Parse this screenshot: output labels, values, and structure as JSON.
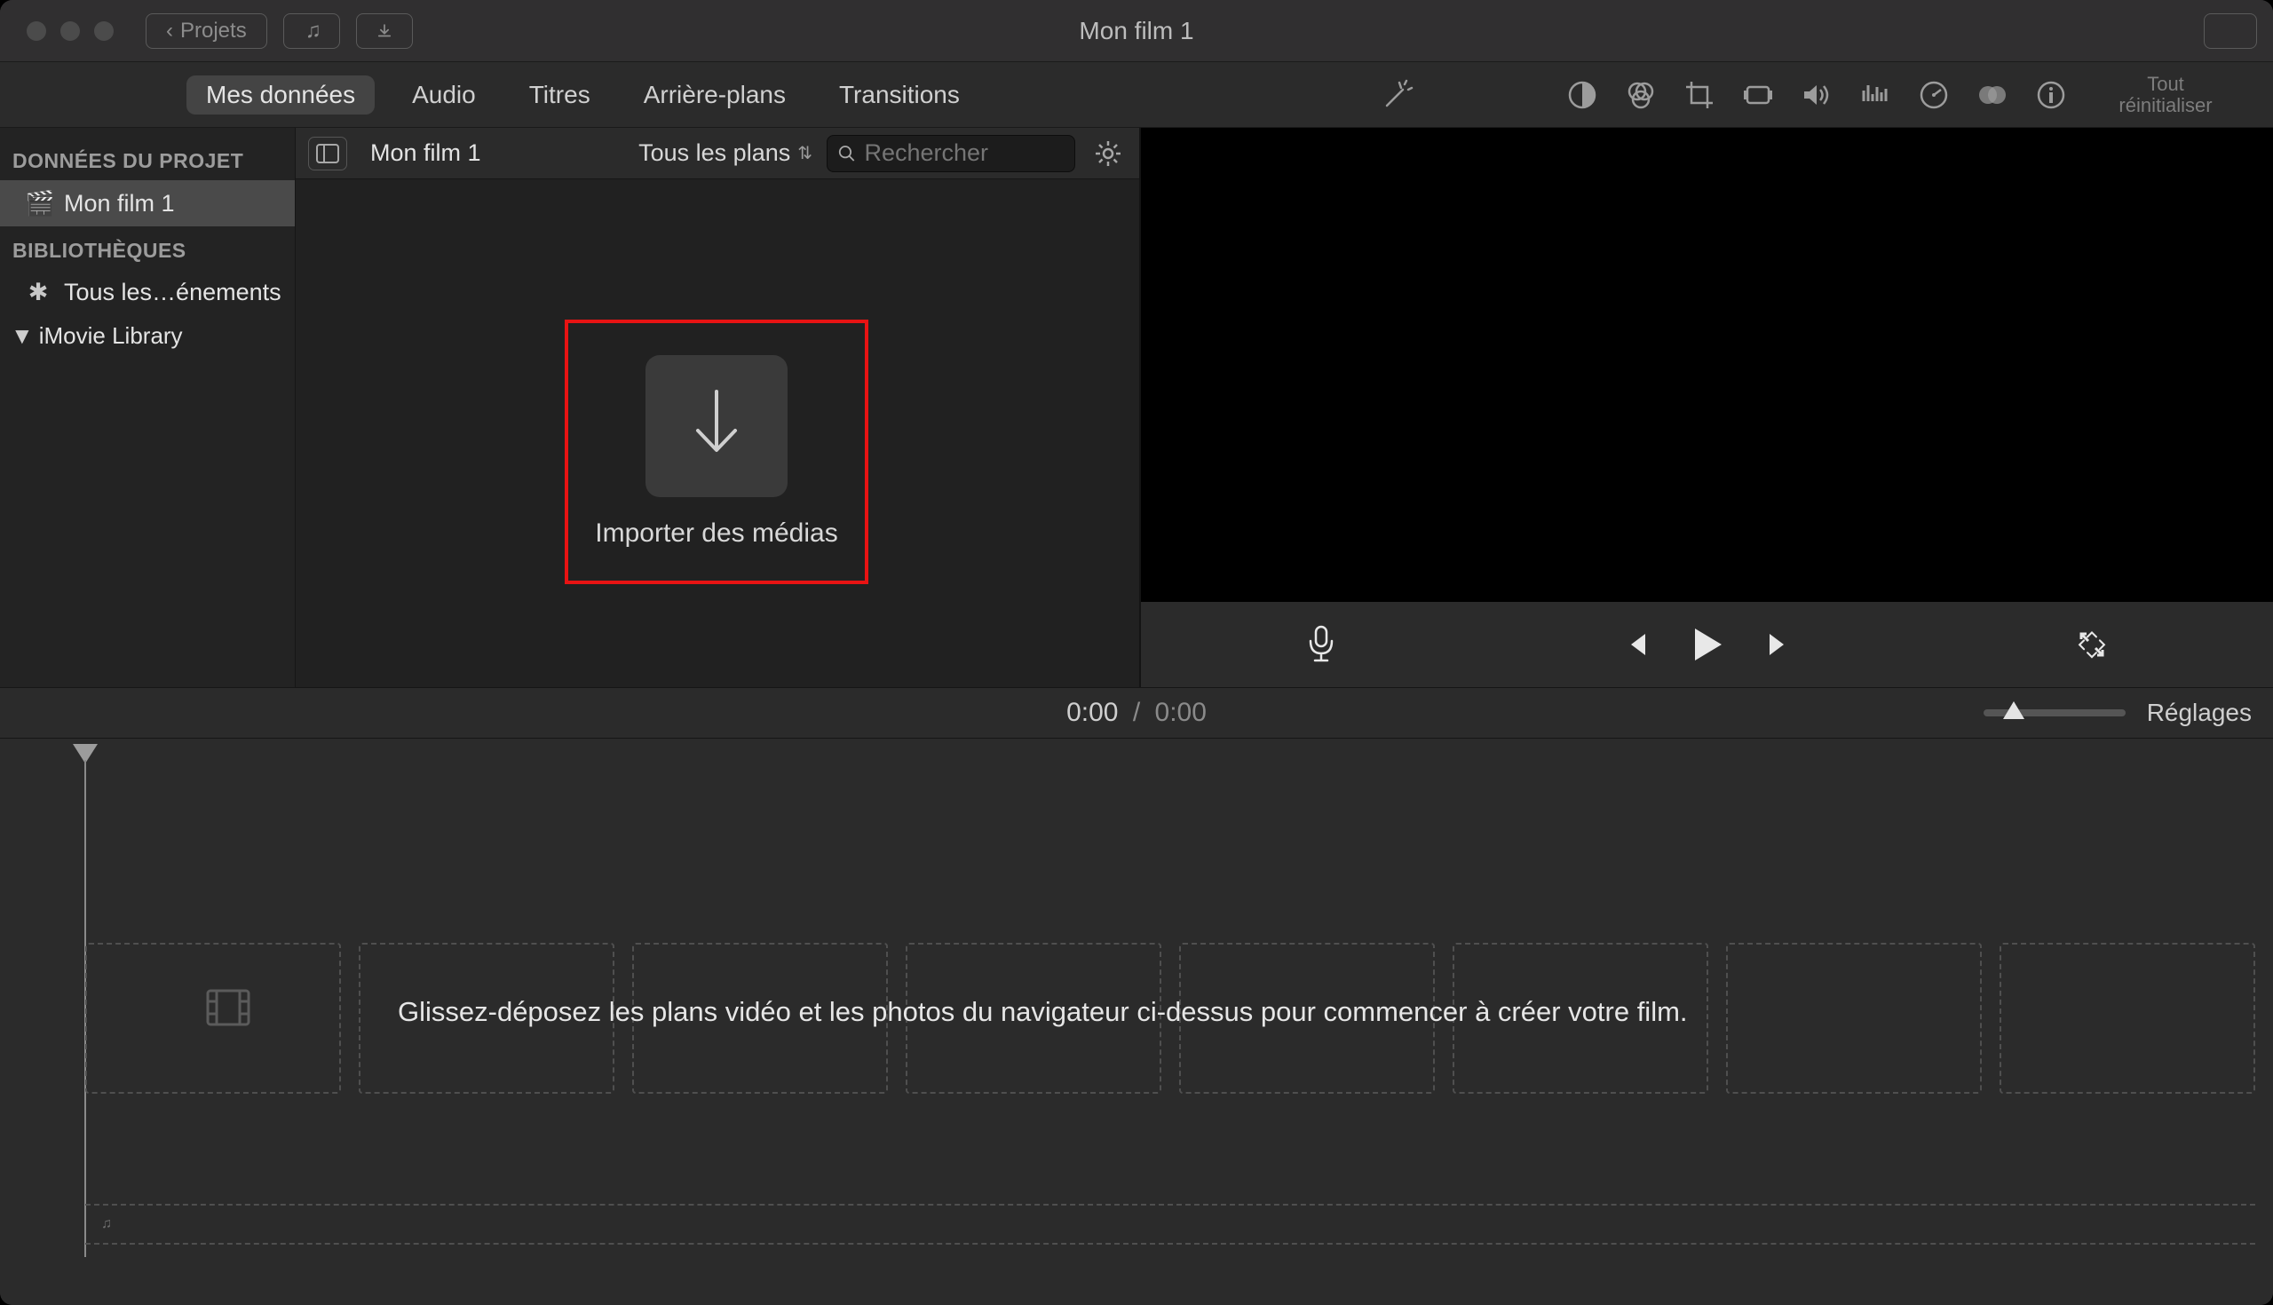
{
  "titlebar": {
    "projects_btn": "Projets",
    "title": "Mon film 1"
  },
  "tabs": {
    "my_media": "Mes données",
    "audio": "Audio",
    "titles": "Titres",
    "backgrounds": "Arrière-plans",
    "transitions": "Transitions"
  },
  "reset": {
    "line1": "Tout",
    "line2": "réinitialiser"
  },
  "sidebar": {
    "project_data_header": "DONNÉES DU PROJET",
    "project_item": "Mon film 1",
    "libraries_header": "BIBLIOTHÈQUES",
    "all_events": "Tous les…énements",
    "imovie_library": "iMovie Library"
  },
  "browser": {
    "layout_tooltip": "layout",
    "project_name": "Mon film 1",
    "filter_label": "Tous les plans",
    "search_placeholder": "Rechercher",
    "import_label": "Importer des médias"
  },
  "timeline": {
    "current": "0:00",
    "sep": "/",
    "duration": "0:00",
    "settings": "Réglages",
    "hint": "Glissez-déposez les plans vidéo et les photos du navigateur ci-dessus pour commencer à créer votre film."
  }
}
